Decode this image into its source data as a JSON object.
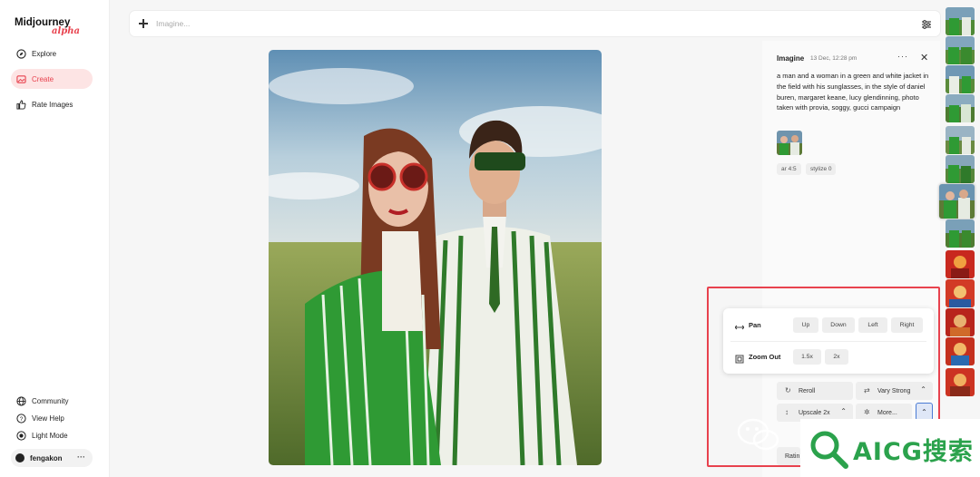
{
  "sidebar": {
    "logo": "Midjourney",
    "logo_sub": "alpha",
    "nav": [
      {
        "label": "Explore",
        "icon": "compass-icon"
      },
      {
        "label": "Create",
        "icon": "image-icon",
        "active": true
      },
      {
        "label": "Rate Images",
        "icon": "thumbs-up-icon"
      }
    ],
    "bottom": [
      {
        "label": "Community",
        "icon": "globe-icon"
      },
      {
        "label": "View Help",
        "icon": "help-icon"
      },
      {
        "label": "Light Mode",
        "icon": "sun-icon"
      }
    ],
    "user": {
      "name": "fengakon",
      "more": "···"
    }
  },
  "prompt": {
    "placeholder": "Imagine..."
  },
  "detail": {
    "type": "Imagine",
    "date": "13 Dec, 12:28 pm",
    "more": "···",
    "close": "✕",
    "prompt_text": "a man and a woman in a green and white jacket in the field with his sunglasses, in the style of daniel buren, margaret keane, lucy glendinning, photo taken with provia, soggy, gucci campaign",
    "params": [
      "ar 4:5",
      "stylize 0"
    ]
  },
  "actions": {
    "pan_label": "Pan",
    "pan_buttons": [
      "Up",
      "Down",
      "Left",
      "Right"
    ],
    "zoom_label": "Zoom Out",
    "zoom_buttons": [
      "1.5x",
      "2x"
    ],
    "reroll": "Reroll",
    "vary": "Vary Strong",
    "upscale": "Upscale 2x",
    "more": "More...",
    "rating": "Ratin",
    "caret": "⌃"
  },
  "watermark": {
    "text": "AICG搜索"
  },
  "colors": {
    "accent": "#e8424e",
    "highlight_border": "#e8424e",
    "watermark": "#2ba24c",
    "expand_border": "#4a7bd4"
  }
}
